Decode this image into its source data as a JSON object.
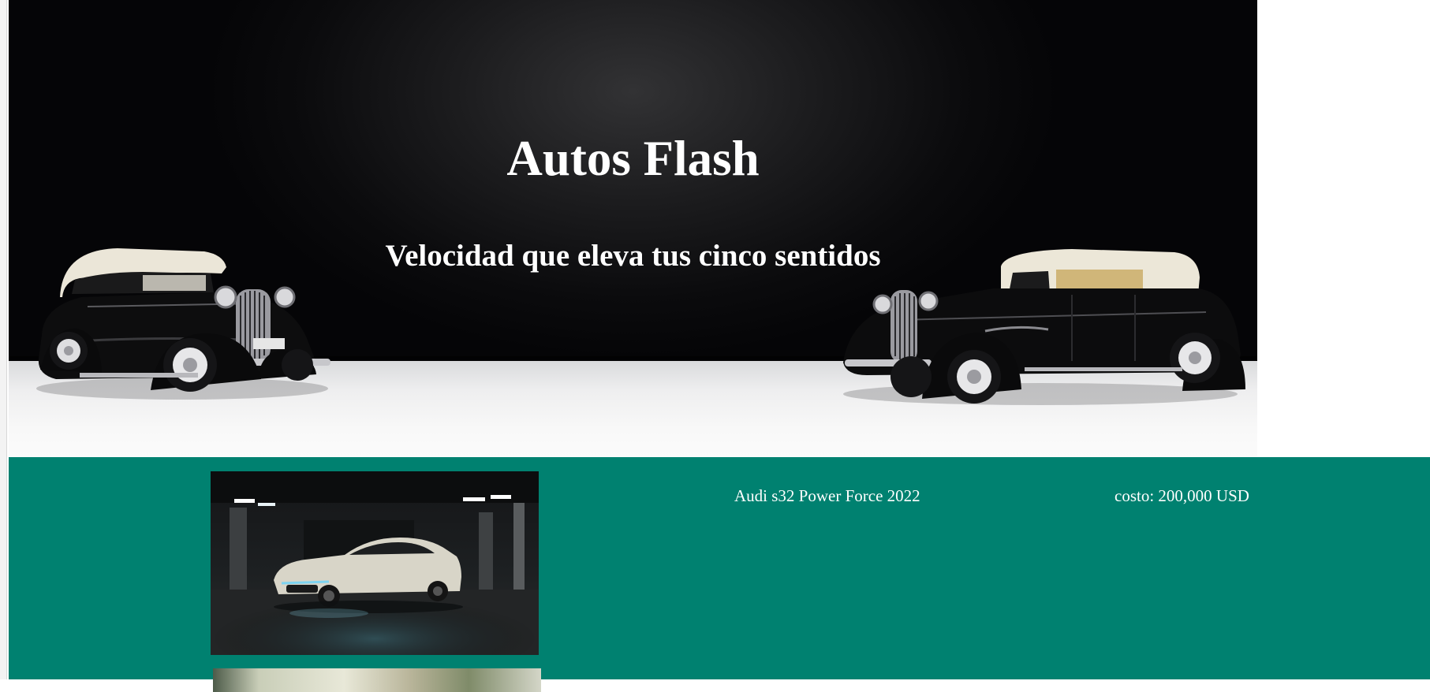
{
  "hero": {
    "title": "Autos Flash",
    "subtitle": "Velocidad que eleva tus cinco sentidos",
    "image": "two-classic-black-convertibles-on-white-floor"
  },
  "listing": {
    "background_color": "#008170",
    "items": [
      {
        "name": "Audi s32 Power Force 2022",
        "price": "costo: 200,000 USD",
        "image": "white-audi-in-dark-parking-garage"
      }
    ]
  }
}
